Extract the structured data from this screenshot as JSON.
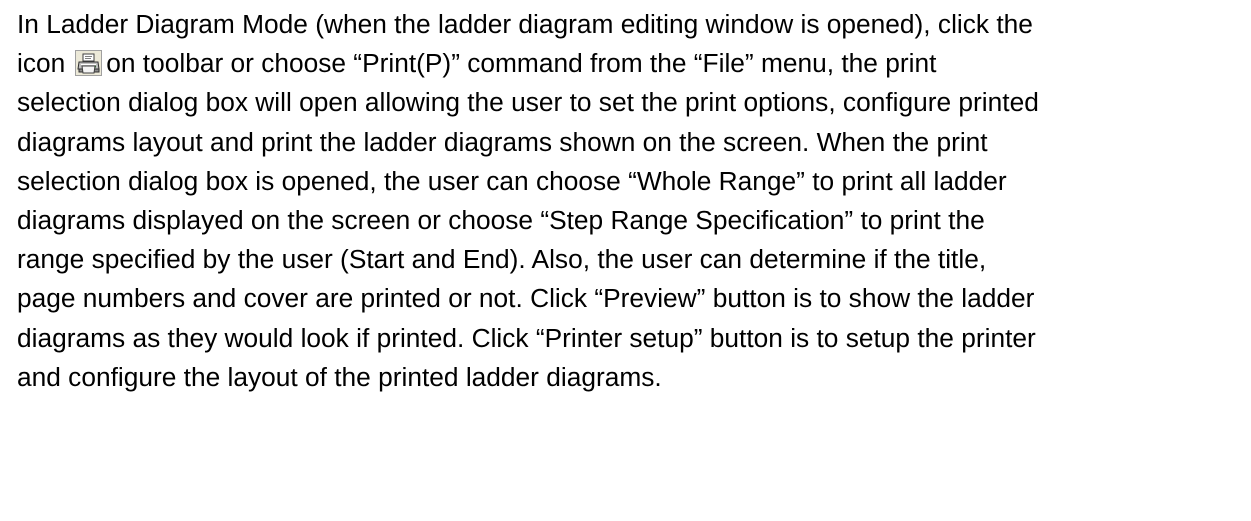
{
  "document": {
    "paragraph": {
      "lines": [
        "In Ladder Diagram Mode (when the ladder diagram editing window is opened), click the",
        "icon",
        "on toolbar or choose “Print(P)” command from the “File” menu, the print",
        "selection dialog box will open allowing the user to set the print options, configure printed",
        "diagrams layout and print the ladder diagrams shown on the screen. When the print",
        "selection dialog box is opened, the user can choose “Whole Range” to print all ladder",
        "diagrams displayed on the screen or choose “Step Range Specification” to print the",
        "range specified by the user (Start and End). Also, the user can determine if the title,",
        "page numbers and cover are printed or not. Click “Preview” button is to show the ladder",
        "diagrams as they would look if printed. Click “Printer setup” button is to setup the printer",
        "and configure the layout of the printed ladder diagrams."
      ],
      "inline_icon": "printer-icon"
    }
  }
}
